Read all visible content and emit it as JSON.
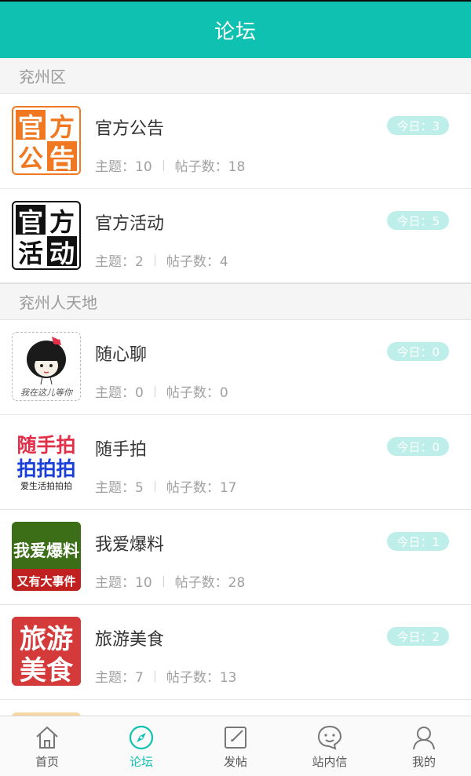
{
  "header": {
    "title": "论坛"
  },
  "sections": [
    {
      "title": "兖州区",
      "forums": [
        {
          "name": "官方公告",
          "topics_label": "主题：10",
          "posts_label": "帖子数：18",
          "today_label": "今日：3",
          "icon": {
            "kind": "quad",
            "chars": [
              "官",
              "方",
              "公",
              "告"
            ]
          }
        },
        {
          "name": "官方活动",
          "topics_label": "主题：2",
          "posts_label": "帖子数：4",
          "today_label": "今日：5",
          "icon": {
            "kind": "quad",
            "chars": [
              "官",
              "方",
              "活",
              "动"
            ]
          }
        }
      ]
    },
    {
      "title": "兖州人天地",
      "forums": [
        {
          "name": "随心聊",
          "topics_label": "主题：0",
          "posts_label": "帖子数：0",
          "today_label": "今日：0",
          "icon": {
            "kind": "cartoon",
            "caption": "我在这儿等你"
          }
        },
        {
          "name": "随手拍",
          "topics_label": "主题：5",
          "posts_label": "帖子数：17",
          "today_label": "今日：0",
          "icon": {
            "kind": "text3",
            "line1": "随手拍",
            "line2": "拍拍拍",
            "line3": "爱生活拍拍拍"
          }
        },
        {
          "name": "我爱爆料",
          "topics_label": "主题：10",
          "posts_label": "帖子数：28",
          "today_label": "今日：1",
          "icon": {
            "kind": "text2",
            "line1": "我爱爆料",
            "line2": "又有大事件"
          }
        },
        {
          "name": "旅游美食",
          "topics_label": "主题：7",
          "posts_label": "帖子数：13",
          "today_label": "今日：2",
          "icon": {
            "kind": "grid4",
            "line1": "旅游",
            "line2": "美食"
          }
        }
      ]
    }
  ],
  "tabs": [
    {
      "label": "首页",
      "icon": "home-icon",
      "active": false
    },
    {
      "label": "论坛",
      "icon": "compass-icon",
      "active": true
    },
    {
      "label": "发帖",
      "icon": "edit-icon",
      "active": false
    },
    {
      "label": "站内信",
      "icon": "chat-icon",
      "active": false
    },
    {
      "label": "我的",
      "icon": "user-icon",
      "active": false
    }
  ],
  "colors": {
    "primary": "#0ec1b1",
    "badge_bg": "#bdeeea",
    "orange": "#f07820",
    "green": "#3c6e18",
    "red": "#d53a3a"
  }
}
